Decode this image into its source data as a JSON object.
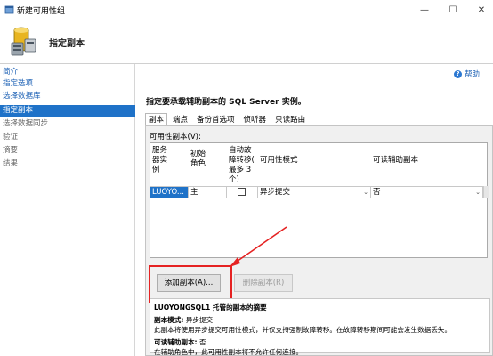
{
  "window": {
    "title": "新建可用性组",
    "minimize": "—",
    "maximize": "☐",
    "close": "✕"
  },
  "header": {
    "title": "指定副本"
  },
  "nav": {
    "items": [
      {
        "label": "简介",
        "state": "link"
      },
      {
        "label": "指定选项",
        "state": "link"
      },
      {
        "label": "选择数据库",
        "state": "link"
      },
      {
        "label": "指定副本",
        "state": "selected"
      },
      {
        "label": "选择数据同步",
        "state": "disabled"
      },
      {
        "label": "验证",
        "state": "disabled"
      },
      {
        "label": "摘要",
        "state": "disabled"
      },
      {
        "label": "结果",
        "state": "disabled"
      }
    ]
  },
  "main": {
    "help": "帮助",
    "help_glyph": "?",
    "instruction": "指定要承载辅助副本的 SQL Server 实例。",
    "tabs": [
      "副本",
      "端点",
      "备份首选项",
      "侦听器",
      "只读路由"
    ],
    "replicas_label": "可用性副本(V):",
    "columns": {
      "server": [
        "服务",
        "器实",
        "例"
      ],
      "role": [
        "初始",
        "角色"
      ],
      "failover": [
        "自动故",
        "障转移(",
        "最多 3",
        "个)"
      ],
      "mode": "可用性模式",
      "readable": "可读辅助副本"
    },
    "row": {
      "server": "LUOYO...",
      "role": "主",
      "failover_checked": false,
      "mode": "异步提交",
      "readable": "否"
    },
    "add_button": "添加副本(A)...",
    "remove_button": "删除副本(R)",
    "summary": {
      "heading": "LUOYONGSQL1 托管的副本的摘要",
      "mode_label": "副本模式:",
      "mode_value": "异步提交",
      "mode_desc": "此副本将使用异步提交可用性模式，并仅支持强制故障转移。在故障转移期间可能会发生数据丢失。",
      "read_label": "可读辅助副本:",
      "read_value": "否",
      "read_desc": "在辅助角色中，此可用性副本将不允许任何连接。"
    },
    "accent_color": "#e52222",
    "selection_color": "#1f72c8"
  }
}
